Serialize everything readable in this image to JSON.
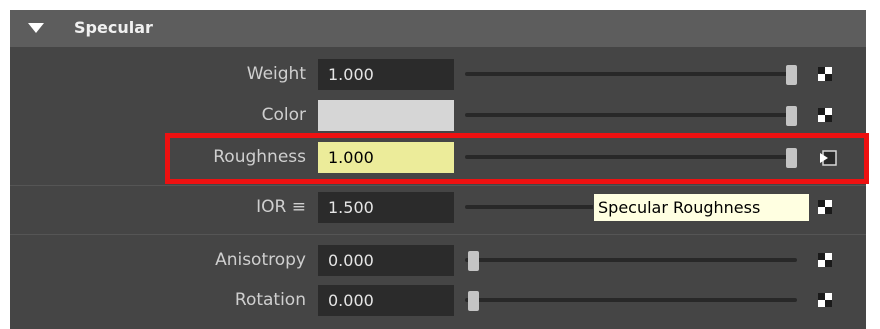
{
  "section": {
    "title": "Specular",
    "expanded": true
  },
  "properties": [
    {
      "id": "weight",
      "label": "Weight",
      "value": "1.000",
      "slider_fraction": 1.0
    },
    {
      "id": "color",
      "label": "Color",
      "value": "",
      "swatch": "#d6d6d6",
      "slider_fraction": 1.0
    },
    {
      "id": "roughness",
      "label": "Roughness",
      "value": "1.000",
      "slider_fraction": 1.0,
      "highlighted": true
    },
    {
      "id": "ior",
      "label": "IOR ≡",
      "value": "1.500",
      "slider_fraction": 0.35
    },
    {
      "id": "anisotropy",
      "label": "Anisotropy",
      "value": "0.000",
      "slider_fraction": 0.0
    },
    {
      "id": "rotation",
      "label": "Rotation",
      "value": "0.000",
      "slider_fraction": 0.0
    }
  ],
  "tooltip": {
    "text": "Specular Roughness"
  },
  "colors": {
    "accent_highlight": "#ee1111",
    "roughness_field": "#ecec9a",
    "tooltip_bg": "#ffffe1"
  },
  "icons": {
    "section_toggle": "triangle-down-icon",
    "map_button": "checker-icon",
    "connection": "input-connection-icon"
  }
}
